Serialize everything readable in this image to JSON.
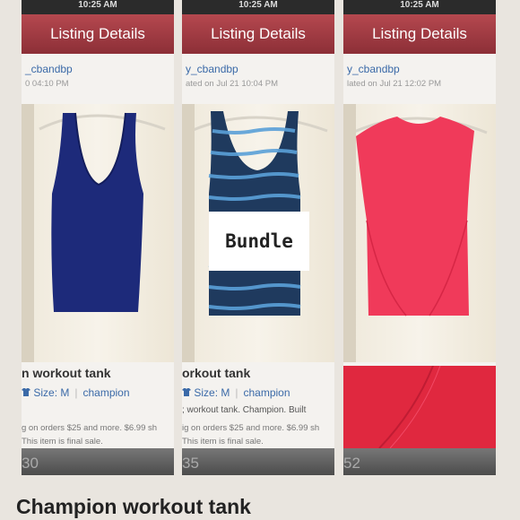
{
  "panels": [
    {
      "status_time": "10:25 AM",
      "nav_title": "Listing Details",
      "seller": "_cbandbp",
      "date": "0 04:10 PM",
      "title": "n workout tank",
      "size_label": "Size: M",
      "brand": "champion",
      "description": "",
      "shipping": "g on orders $25 and more. $6.99 sh",
      "final_sale": "This item is final sale.",
      "price": "30",
      "garment_color": "#1d2a7a"
    },
    {
      "status_time": "10:25 AM",
      "nav_title": "Listing Details",
      "seller": "y_cbandbp",
      "date": "ated on Jul 21 10:04 PM",
      "title": "orkout tank",
      "size_label": "Size: M",
      "brand": "champion",
      "description": "; workout tank. Champion. Built",
      "shipping": "ig on orders $25 and more. $6.99 sh",
      "final_sale": "This item is final sale.",
      "price": "35",
      "overlay_label": "Bundle",
      "garment_color": "#1f3a5e",
      "stripe_color": "#5aa0d8"
    },
    {
      "status_time": "10:25 AM",
      "nav_title": "Listing Details",
      "seller": "y_cbandbp",
      "date": "lated on Jul 21 12:02 PM",
      "price": "52",
      "garment_color": "#f03a5a"
    }
  ],
  "caption": "Champion workout tank",
  "colors": {
    "nav": "#a53d45",
    "link": "#3b6aa8"
  }
}
